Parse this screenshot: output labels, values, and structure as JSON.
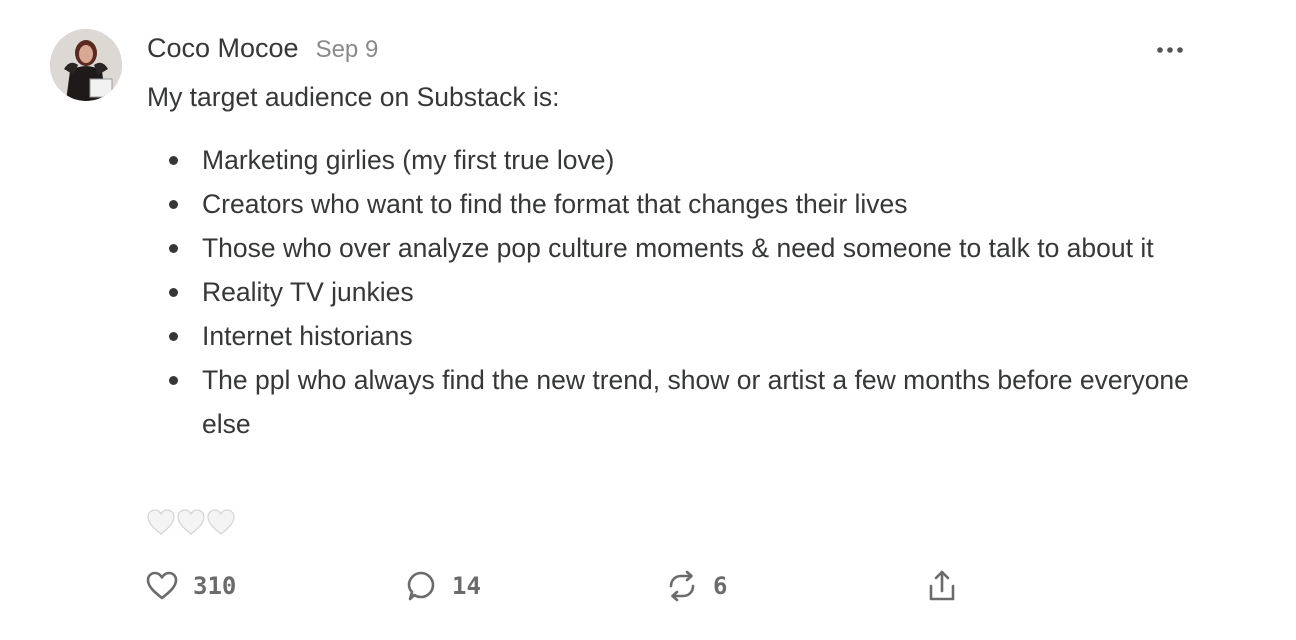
{
  "note": {
    "author": "Coco Mocoe",
    "date": "Sep 9",
    "intro": "My target audience on Substack is:",
    "items": [
      "Marketing girlies (my first true love)",
      "Creators who want to find the format that changes their lives",
      "Those who over analyze pop culture moments & need someone to talk to about it",
      "Reality TV junkies",
      "Internet historians",
      "The ppl who always find the new trend, show or artist a few months before everyone else"
    ],
    "reaction_icons": [
      "white-heart-icon",
      "white-heart-icon",
      "white-heart-icon"
    ]
  },
  "actions": {
    "likes": "310",
    "comments": "14",
    "restacks": "6"
  },
  "icons": {
    "more": "more-horizontal-icon",
    "like": "heart-outline-icon",
    "comment": "comment-bubble-icon",
    "restack": "restack-icon",
    "share": "share-icon"
  },
  "colors": {
    "text": "#363737",
    "muted": "#8a8a8a",
    "icon": "#6b6b6b"
  }
}
